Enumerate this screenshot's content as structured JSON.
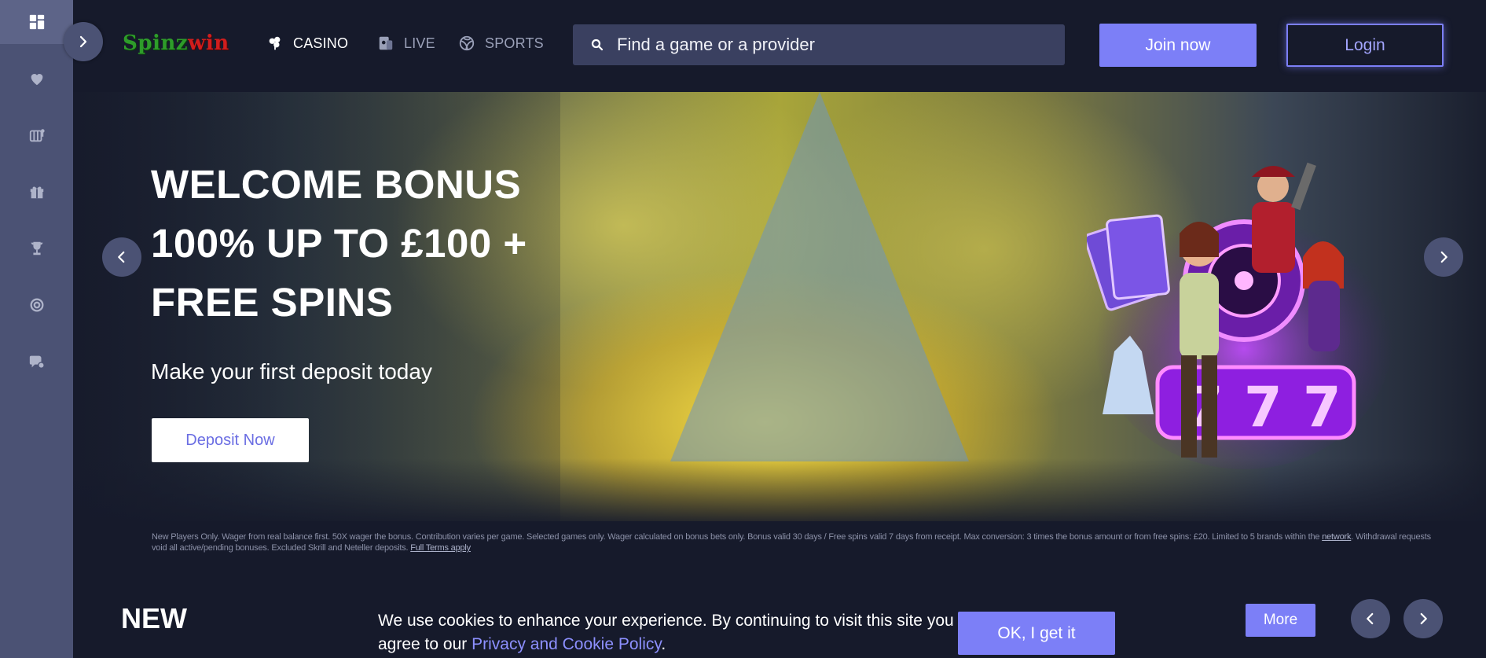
{
  "brand": {
    "logo_part1": "Spinz",
    "logo_part2": "win"
  },
  "nav": {
    "casino": "CASINO",
    "live": "LIVE",
    "sports": "SPORTS"
  },
  "search": {
    "placeholder": "Find a game or a provider"
  },
  "header": {
    "join_label": "Join now",
    "login_label": "Login"
  },
  "sidebar": {
    "items": [
      {
        "icon": "dashboard-icon"
      },
      {
        "icon": "heart-icon"
      },
      {
        "icon": "slot-machine-icon"
      },
      {
        "icon": "gift-icon"
      },
      {
        "icon": "trophy-icon"
      },
      {
        "icon": "target-icon"
      },
      {
        "icon": "support-chat-icon"
      }
    ]
  },
  "hero": {
    "title_line1": "WELCOME BONUS",
    "title_line2": "100% UP TO £100 +",
    "title_line3": "FREE SPINS",
    "subtitle": "Make your first deposit today",
    "cta_label": "Deposit Now"
  },
  "terms": {
    "text_before_network": "New Players Only. Wager from real balance first. 50X wager the bonus. Contribution varies per game. Selected games only. Wager calculated on bonus bets only. Bonus valid 30 days / Free spins valid 7 days from receipt. Max conversion: 3 times the bonus amount or from free spins: £20. Limited to 5 brands within the ",
    "network_link": "network",
    "text_after_network": ". Withdrawal requests void all active/pending bonuses. Excluded Skrill and Neteller deposits. ",
    "full_terms_link": "Full Terms apply"
  },
  "section": {
    "new_heading": "NEW",
    "more_label": "More"
  },
  "cookie": {
    "text": "We use cookies to enhance your experience. By continuing to visit this site you agree to our ",
    "link": "Privacy and Cookie Policy",
    "suffix": ".",
    "ok_label": "OK, I get it"
  },
  "colors": {
    "accent": "#7c7ff7",
    "sidebar_bg": "#4b5274",
    "page_bg": "#161a2b"
  }
}
